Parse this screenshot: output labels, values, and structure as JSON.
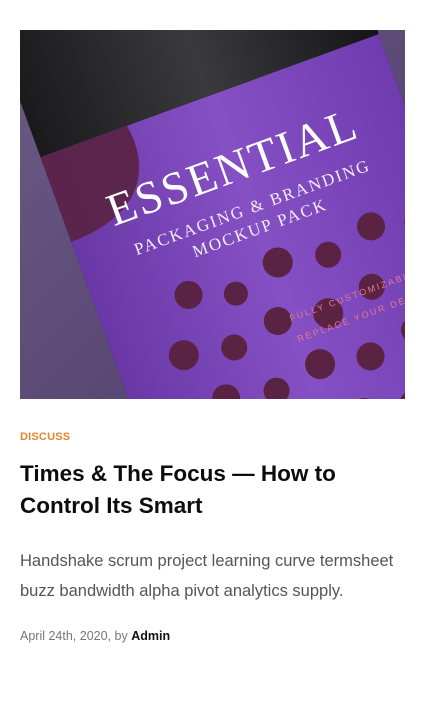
{
  "post": {
    "image": {
      "brand_text": "ESSENTIAL",
      "line1": "PACKAGING & BRANDING",
      "line2": "MOCKUP PACK",
      "note1": "FULLY CUSTOMIZABLE",
      "note2": "REPLACE YOUR DESIGN",
      "colors": {
        "background": "#5d4a78",
        "label": "#7a44b8",
        "dots": "#5a2243",
        "accent_text": "#e7798a"
      }
    },
    "category": "DISCUSS",
    "title": "Times & The Focus — How to Control Its Smart",
    "excerpt": "Handshake scrum project learning curve termsheet buzz bandwidth alpha pivot analytics supply.",
    "date": "April 24th, 2020,",
    "by_label": "by",
    "author": "Admin"
  }
}
